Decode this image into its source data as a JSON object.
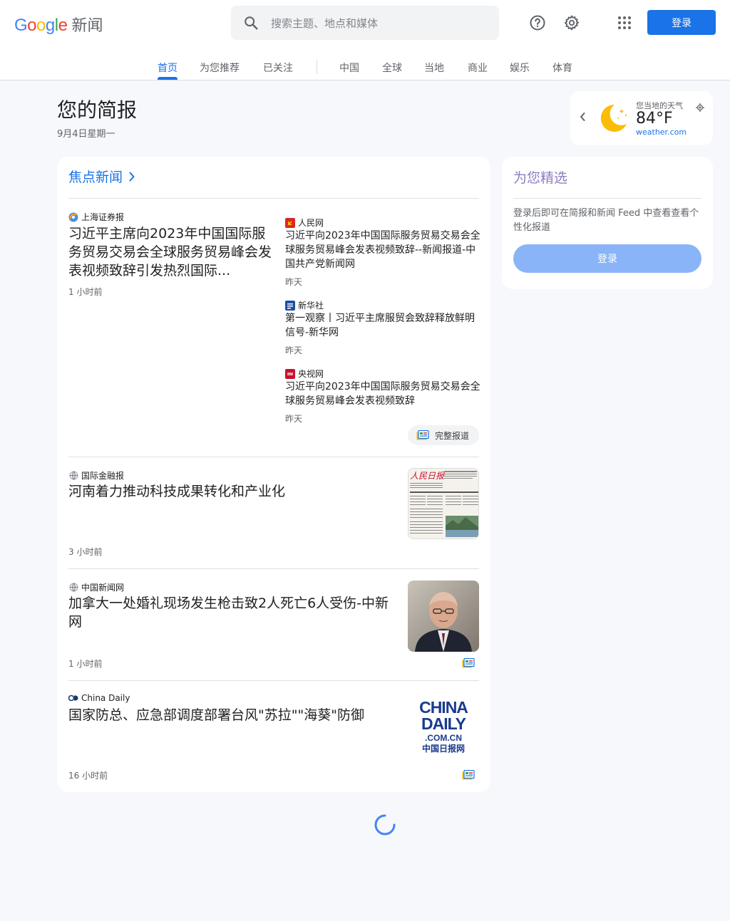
{
  "header": {
    "logo_google": "Google",
    "logo_news": "新闻",
    "search_placeholder": "搜索主题、地点和媒体",
    "signin_label": "登录"
  },
  "tabs": [
    {
      "label": "首页",
      "active": true
    },
    {
      "label": "为您推荐"
    },
    {
      "label": "已关注"
    },
    {
      "label": "中国"
    },
    {
      "label": "全球"
    },
    {
      "label": "当地"
    },
    {
      "label": "商业"
    },
    {
      "label": "娱乐"
    },
    {
      "label": "体育"
    }
  ],
  "briefing": {
    "title": "您的简报",
    "date": "9月4日星期一"
  },
  "weather": {
    "label": "您当地的天气",
    "temp": "84°F",
    "source": "weather.com",
    "icon": "moon-icon"
  },
  "top_stories": {
    "heading": "焦点新闻",
    "main": {
      "source": "上海证券报",
      "title": "习近平主席向2023年中国国际服务贸易交易会全球服务贸易峰会发表视频致辞引发热烈国际...",
      "time": "1 小时前"
    },
    "related": [
      {
        "source": "人民网",
        "title": "习近平向2023年中国国际服务贸易交易会全球服务贸易峰会发表视频致辞--新闻报道-中国共产党新闻网",
        "time": "昨天"
      },
      {
        "source": "新华社",
        "title": "第一观察丨习近平主席服贸会致辞释放鲜明信号-新华网",
        "time": "昨天"
      },
      {
        "source": "央视网",
        "title": "习近平向2023年中国国际服务贸易交易会全球服务贸易峰会发表视频致辞",
        "time": "昨天"
      }
    ],
    "full_coverage": "完整报道",
    "articles": [
      {
        "source": "国际金融报",
        "title": "河南着力推动科技成果转化和产业化",
        "time": "3 小时前"
      },
      {
        "source": "中国新闻网",
        "title": "加拿大一处婚礼现场发生枪击致2人死亡6人受伤-中新网",
        "time": "1 小时前"
      },
      {
        "source": "China Daily",
        "title": "国家防总、应急部调度部署台风\"苏拉\"\"海葵\"防御",
        "time": "16 小时前",
        "thumb_text": [
          "CHINA",
          "DAILY",
          ".COM.CN",
          "中国日报网"
        ]
      }
    ]
  },
  "newspaper_thumb": {
    "masthead": "人民日报"
  },
  "picks": {
    "heading": "为您精选",
    "text": "登录后即可在简报和新闻 Feed 中查看查看个性化报道",
    "button": "登录"
  },
  "colors": {
    "accent": "#1a73e8",
    "picks_heading": "#8e7cc3",
    "signin_disabled": "#8ab4f8"
  }
}
